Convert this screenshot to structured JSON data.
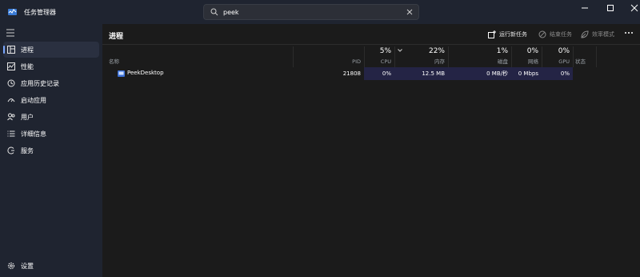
{
  "app": {
    "title": "任务管理器"
  },
  "search": {
    "value": "peek",
    "placeholder": ""
  },
  "sidebar": {
    "items": [
      {
        "label": "进程",
        "icon": "processes-icon",
        "active": true
      },
      {
        "label": "性能",
        "icon": "performance-icon"
      },
      {
        "label": "应用历史记录",
        "icon": "app-history-icon"
      },
      {
        "label": "启动应用",
        "icon": "startup-apps-icon"
      },
      {
        "label": "用户",
        "icon": "users-icon"
      },
      {
        "label": "详细信息",
        "icon": "details-icon"
      },
      {
        "label": "服务",
        "icon": "services-icon"
      }
    ],
    "settings_label": "设置"
  },
  "main": {
    "title": "进程",
    "toolbar": {
      "run_new_task": "运行新任务",
      "end_task": "结束任务",
      "efficiency_mode": "效率模式"
    },
    "columns": {
      "name": "名称",
      "pid": "PID",
      "cpu": {
        "pct": "5%",
        "label": "CPU"
      },
      "memory": {
        "pct": "22%",
        "label": "内存"
      },
      "disk": {
        "pct": "1%",
        "label": "磁盘"
      },
      "network": {
        "pct": "0%",
        "label": "网络"
      },
      "gpu": {
        "pct": "0%",
        "label": "GPU"
      },
      "status": "状态"
    },
    "rows": [
      {
        "name": "PeekDesktop",
        "pid": "21808",
        "cpu": "0%",
        "memory": "12.5 MB",
        "disk": "0 MB/秒",
        "network": "0 Mbps",
        "gpu": "0%",
        "status": ""
      }
    ]
  },
  "colors": {
    "accent": "#7aa7ff",
    "sidebar_bg": "#1f2430",
    "main_bg": "#1b1b1b",
    "highlight": "#242445"
  }
}
